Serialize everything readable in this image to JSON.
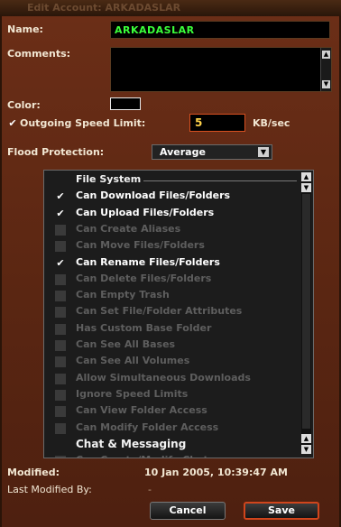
{
  "window": {
    "title": "Edit Account: ARKADASLAR"
  },
  "form": {
    "name_label": "Name:",
    "name_value": "ARKADASLAR",
    "comments_label": "Comments:",
    "comments_value": "",
    "color_label": "Color:",
    "color_value": "#000000",
    "speed_limit_label": "Outgoing Speed Limit:",
    "speed_limit_checked": true,
    "speed_limit_value": "5",
    "speed_unit": "KB/sec",
    "flood_label": "Flood Protection:",
    "flood_value": "Average"
  },
  "permissions": [
    {
      "type": "section",
      "label": "File System"
    },
    {
      "type": "item",
      "label": "Can Download Files/Folders",
      "checked": true
    },
    {
      "type": "item",
      "label": "Can Upload Files/Folders",
      "checked": true
    },
    {
      "type": "item",
      "label": "Can Create Aliases",
      "checked": false
    },
    {
      "type": "item",
      "label": "Can Move Files/Folders",
      "checked": false
    },
    {
      "type": "item",
      "label": "Can Rename Files/Folders",
      "checked": true
    },
    {
      "type": "item",
      "label": "Can Delete Files/Folders",
      "checked": false
    },
    {
      "type": "item",
      "label": "Can Empty Trash",
      "checked": false
    },
    {
      "type": "item",
      "label": "Can Set File/Folder Attributes",
      "checked": false
    },
    {
      "type": "item",
      "label": "Has Custom Base Folder",
      "checked": false
    },
    {
      "type": "item",
      "label": "Can See All Bases",
      "checked": false
    },
    {
      "type": "item",
      "label": "Can See All Volumes",
      "checked": false
    },
    {
      "type": "item",
      "label": "Allow Simultaneous Downloads",
      "checked": false
    },
    {
      "type": "item",
      "label": "Ignore Speed Limits",
      "checked": false
    },
    {
      "type": "item",
      "label": "Can View Folder Access",
      "checked": false
    },
    {
      "type": "item",
      "label": "Can Modify Folder Access",
      "checked": false
    },
    {
      "type": "section",
      "label": "Chat & Messaging"
    },
    {
      "type": "item",
      "label": "Can Create/Modify Chats",
      "checked": false
    }
  ],
  "footer": {
    "modified_label": "Modified:",
    "modified_value": "10 Jan 2005, 10:39:47 AM",
    "last_modified_label": "Last Modified By:",
    "last_modified_value": "-",
    "cancel_label": "Cancel",
    "save_label": "Save"
  }
}
